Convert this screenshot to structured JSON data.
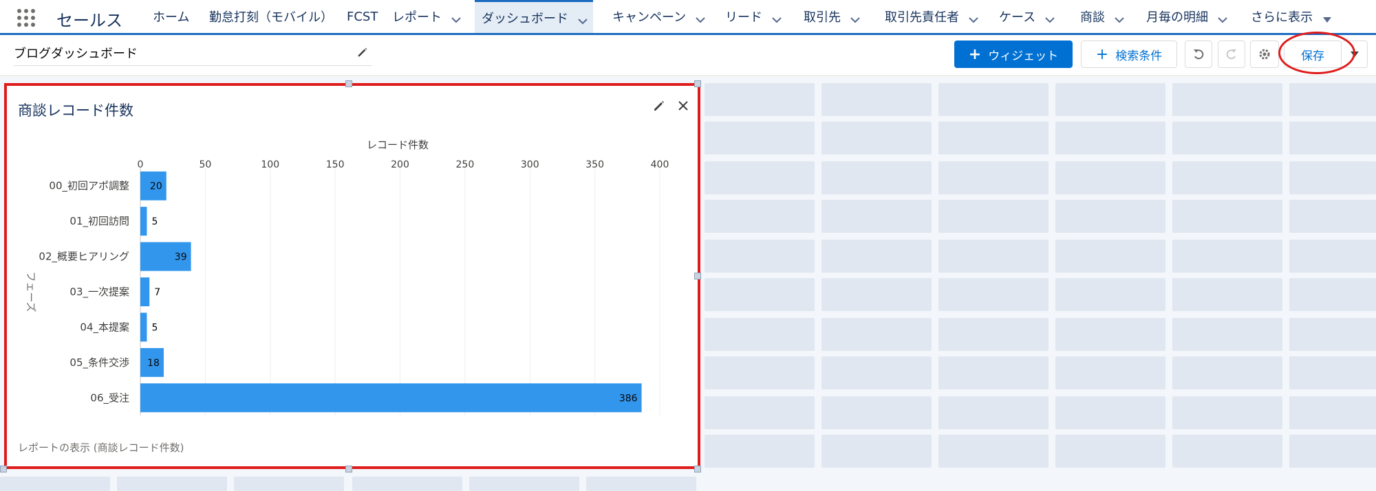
{
  "app": {
    "name": "セールス"
  },
  "nav": {
    "tabs": [
      {
        "label": "ホーム",
        "dropdown": false,
        "active": false
      },
      {
        "label": "勤怠打刻（モバイル）",
        "dropdown": false,
        "active": false
      },
      {
        "label": "FCST",
        "dropdown": false,
        "active": false
      },
      {
        "label": "レポート",
        "dropdown": true,
        "active": false
      },
      {
        "label": "ダッシュボード",
        "dropdown": true,
        "active": true
      },
      {
        "label": "キャンペーン",
        "dropdown": true,
        "active": false
      },
      {
        "label": "リード",
        "dropdown": true,
        "active": false
      },
      {
        "label": "取引先",
        "dropdown": true,
        "active": false
      },
      {
        "label": "取引先責任者",
        "dropdown": true,
        "active": false
      },
      {
        "label": "ケース",
        "dropdown": true,
        "active": false
      },
      {
        "label": "商談",
        "dropdown": true,
        "active": false
      },
      {
        "label": "月毎の明細",
        "dropdown": true,
        "active": false
      },
      {
        "label": "さらに表示",
        "dropdown": true,
        "active": false
      }
    ]
  },
  "toolbar": {
    "dashboard_title": "ブログダッシュボード",
    "widget_label": "ウィジェット",
    "filter_label": "検索条件",
    "save_label": "保存"
  },
  "widget": {
    "title": "商談レコード件数",
    "footer_link": "レポートの表示 (商談レコード件数)"
  },
  "colors": {
    "accent": "#0070d2",
    "bar": "#3296ed",
    "highlight": "#e01b1b"
  },
  "chart_data": {
    "type": "bar",
    "orientation": "horizontal",
    "xlabel": "レコード件数",
    "ylabel": "フェーズ",
    "xlim": [
      0,
      400
    ],
    "xticks": [
      0,
      50,
      100,
      150,
      200,
      250,
      300,
      350,
      400
    ],
    "categories": [
      "00_初回アポ調整",
      "01_初回訪問",
      "02_概要ヒアリング",
      "03_一次提案",
      "04_本提案",
      "05_条件交渉",
      "06_受注"
    ],
    "values": [
      20,
      5,
      39,
      7,
      5,
      18,
      386
    ],
    "grid": true
  }
}
